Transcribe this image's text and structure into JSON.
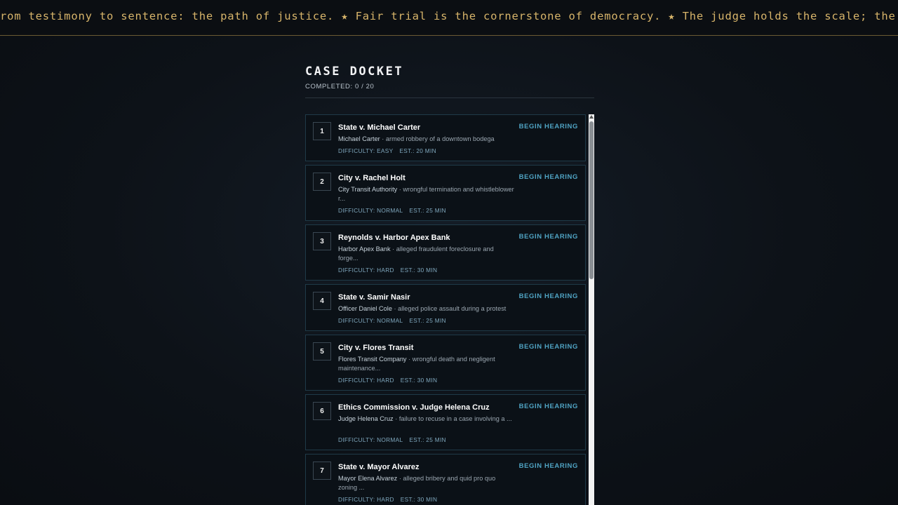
{
  "ticker": {
    "text": "rom testimony to sentence: the path of justice. ★ Fair trial is the cornerstone of democracy. ★ The judge holds the scale; the law holds th"
  },
  "docket": {
    "title": "CASE DOCKET",
    "completed": "COMPLETED: 0 / 20"
  },
  "cases": [
    {
      "num": "1",
      "title": "State v. Michael Carter",
      "party": "Michael Carter",
      "desc": " · armed robbery of a downtown bodega",
      "difficulty": "DIFFICULTY: EASY",
      "est": "EST.: 20 MIN",
      "action": "BEGIN HEARING"
    },
    {
      "num": "2",
      "title": "City v. Rachel Holt",
      "party": "City Transit Authority",
      "desc": " · wrongful termination and whistleblower r...",
      "difficulty": "DIFFICULTY: NORMAL",
      "est": "EST.: 25 MIN",
      "action": "BEGIN HEARING"
    },
    {
      "num": "3",
      "title": "Reynolds v. Harbor Apex Bank",
      "party": "Harbor Apex Bank",
      "desc": " · alleged fraudulent foreclosure and forge...",
      "difficulty": "DIFFICULTY: HARD",
      "est": "EST.: 30 MIN",
      "action": "BEGIN HEARING"
    },
    {
      "num": "4",
      "title": "State v. Samir Nasir",
      "party": "Officer Daniel Cole",
      "desc": " · alleged police assault during a protest",
      "difficulty": "DIFFICULTY: NORMAL",
      "est": "EST.: 25 MIN",
      "action": "BEGIN HEARING"
    },
    {
      "num": "5",
      "title": "City v. Flores Transit",
      "party": "Flores Transit Company",
      "desc": " · wrongful death and negligent maintenance...",
      "difficulty": "DIFFICULTY: HARD",
      "est": "EST.: 30 MIN",
      "action": "BEGIN HEARING"
    },
    {
      "num": "6",
      "title": "Ethics Commission v. Judge Helena Cruz",
      "party": "Judge Helena Cruz",
      "desc": " · failure to recuse in a case involving a ...",
      "difficulty": "DIFFICULTY: NORMAL",
      "est": "EST.: 25 MIN",
      "action": "BEGIN HEARING"
    },
    {
      "num": "7",
      "title": "State v. Mayor Alvarez",
      "party": "Mayor Elena Alvarez",
      "desc": " · alleged bribery and quid pro quo zoning ...",
      "difficulty": "DIFFICULTY: HARD",
      "est": "EST.: 30 MIN",
      "action": "BEGIN HEARING"
    }
  ]
}
